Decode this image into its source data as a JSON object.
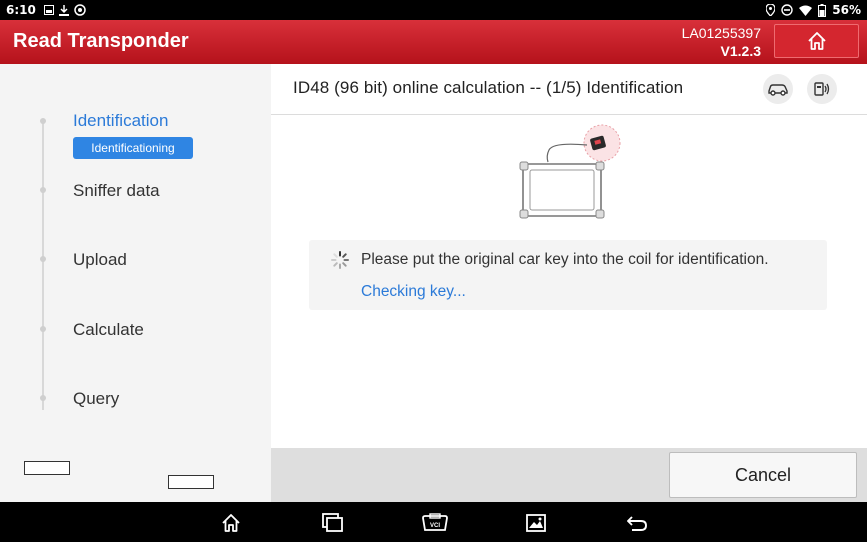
{
  "status_bar": {
    "time": "6:10",
    "battery": "56%",
    "left_icons": [
      "image-notification-icon",
      "download-notification-icon",
      "settings-notification-icon"
    ],
    "right_icons": [
      "location-icon",
      "do-not-disturb-icon",
      "wifi-icon",
      "battery-icon"
    ]
  },
  "header": {
    "title": "Read Transponder",
    "serial": "LA01255397",
    "version": "V1.2.3",
    "home_icon": "home-icon",
    "accent_color": "#c8202a"
  },
  "steps": {
    "items": [
      {
        "label": "Identification",
        "state": "active"
      },
      {
        "label": "Sniffer data",
        "state": "pending"
      },
      {
        "label": "Upload",
        "state": "pending"
      },
      {
        "label": "Calculate",
        "state": "pending"
      },
      {
        "label": "Query",
        "state": "pending"
      }
    ],
    "active_badge": "Identificationing",
    "active_color": "#2b7ad8"
  },
  "main": {
    "title": "ID48 (96 bit) online calculation -- (1/5) Identification",
    "title_icons": [
      "car-icon",
      "vci-connector-icon"
    ],
    "message": "Please put the original car key into the coil for identification.",
    "status": "Checking key...",
    "illustration_icon": "tablet-key-coil-icon"
  },
  "actions": {
    "cancel_label": "Cancel"
  },
  "navbar": {
    "icons": [
      "home-icon",
      "recent-apps-icon",
      "vci-icon",
      "screenshot-icon",
      "back-icon"
    ]
  }
}
